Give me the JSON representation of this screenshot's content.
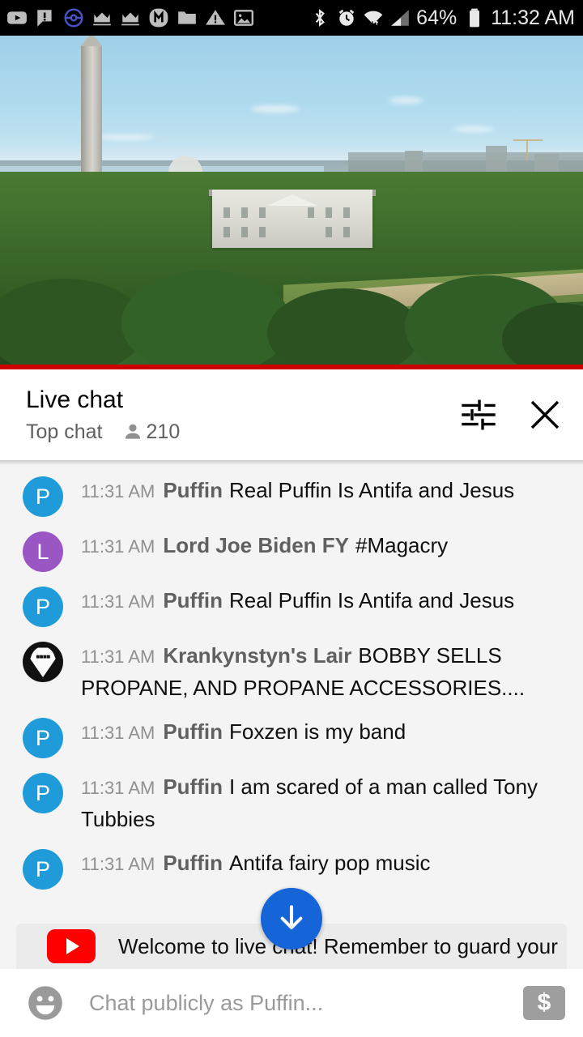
{
  "status_bar": {
    "left_icons": [
      {
        "name": "youtube-icon",
        "label": "YouTube"
      },
      {
        "name": "message-alert-icon",
        "label": "Message alert"
      },
      {
        "name": "pokemon-go-icon",
        "label": "Pokemon GO"
      },
      {
        "name": "crown-icon-1",
        "label": "Crown"
      },
      {
        "name": "crown-icon-2",
        "label": "Crown"
      },
      {
        "name": "m-app-icon",
        "label": "M"
      },
      {
        "name": "folder-icon",
        "label": "Folder"
      },
      {
        "name": "warning-icon",
        "label": "Warning"
      },
      {
        "name": "image-icon",
        "label": "Image"
      }
    ],
    "right_icons": [
      {
        "name": "bluetooth-icon",
        "label": "Bluetooth"
      },
      {
        "name": "alarm-icon",
        "label": "Alarm"
      },
      {
        "name": "wifi-icon",
        "label": "Wi-Fi"
      },
      {
        "name": "cell-signal-icon",
        "label": "Cellular signal"
      }
    ],
    "battery_percent": "64%",
    "time": "11:32 AM"
  },
  "video": {
    "progress_color": "#cc0000",
    "description": "Live aerial view of the White House and Washington Monument"
  },
  "chat_header": {
    "title": "Live chat",
    "mode": "Top chat",
    "viewer_count": "210",
    "settings_icon": "tune-icon",
    "close_icon": "close-icon"
  },
  "messages": [
    {
      "avatar_type": "letter",
      "avatar_letter": "P",
      "avatar_color": "#1e9bd8",
      "time": "11:31 AM",
      "author": "Puffin",
      "text": "Real Puffin Is Antifa and Jesus"
    },
    {
      "avatar_type": "letter",
      "avatar_letter": "L",
      "avatar_color": "#9a57c4",
      "time": "11:31 AM",
      "author": "Lord Joe Biden FY",
      "text": "#Magacry"
    },
    {
      "avatar_type": "letter",
      "avatar_letter": "P",
      "avatar_color": "#1e9bd8",
      "time": "11:31 AM",
      "author": "Puffin",
      "text": "Real Puffin Is Antifa and Jesus"
    },
    {
      "avatar_type": "image",
      "avatar_letter": "",
      "avatar_color": "#111111",
      "time": "11:31 AM",
      "author": "Krankynstyn's Lair",
      "text": "BOBBY SELLS PROPANE, AND PROPANE ACCESSORIES...."
    },
    {
      "avatar_type": "letter",
      "avatar_letter": "P",
      "avatar_color": "#1e9bd8",
      "time": "11:31 AM",
      "author": "Puffin",
      "text": "Foxzen is my band"
    },
    {
      "avatar_type": "letter",
      "avatar_letter": "P",
      "avatar_color": "#1e9bd8",
      "time": "11:31 AM",
      "author": "Puffin",
      "text": "I am scared of a man called Tony Tubbies"
    },
    {
      "avatar_type": "letter",
      "avatar_letter": "P",
      "avatar_color": "#1e9bd8",
      "time": "11:31 AM",
      "author": "Puffin",
      "text": "Antifa fairy pop music"
    }
  ],
  "scroll_fab": {
    "icon": "arrow-down-icon",
    "color": "#1565d8"
  },
  "welcome_banner": {
    "icon": "youtube-logo-icon",
    "text": "Welcome to live chat! Remember to guard your"
  },
  "composer": {
    "emoji_icon": "emoji-smiley-icon",
    "placeholder": "Chat publicly as Puffin...",
    "value": "",
    "superchat_icon": "dollar-icon",
    "superchat_symbol": "$"
  }
}
